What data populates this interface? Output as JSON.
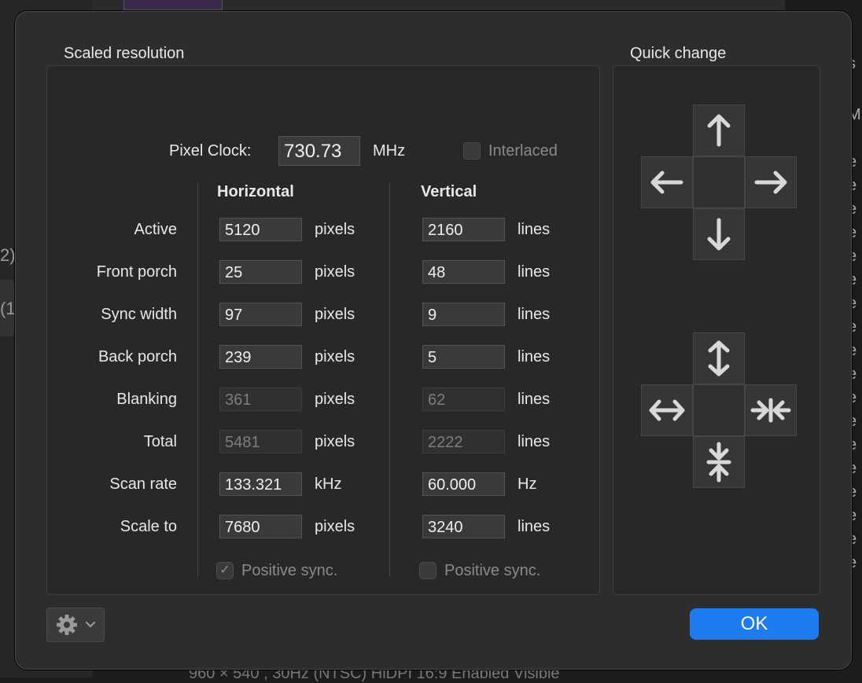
{
  "dialog": {
    "scaled_resolution_title": "Scaled resolution",
    "quick_change_title": "Quick change",
    "pixel_clock_label": "Pixel Clock:",
    "pixel_clock_value": "730.73",
    "pixel_clock_unit": "MHz",
    "interlaced_label": "Interlaced",
    "interlaced_checked": false,
    "horizontal_header": "Horizontal",
    "vertical_header": "Vertical",
    "rows": [
      {
        "label": "Active",
        "h": "5120",
        "h_unit": "pixels",
        "v": "2160",
        "v_unit": "lines",
        "editable": true
      },
      {
        "label": "Front porch",
        "h": "25",
        "h_unit": "pixels",
        "v": "48",
        "v_unit": "lines",
        "editable": true
      },
      {
        "label": "Sync width",
        "h": "97",
        "h_unit": "pixels",
        "v": "9",
        "v_unit": "lines",
        "editable": true
      },
      {
        "label": "Back porch",
        "h": "239",
        "h_unit": "pixels",
        "v": "5",
        "v_unit": "lines",
        "editable": true
      },
      {
        "label": "Blanking",
        "h": "361",
        "h_unit": "pixels",
        "v": "62",
        "v_unit": "lines",
        "editable": false
      },
      {
        "label": "Total",
        "h": "5481",
        "h_unit": "pixels",
        "v": "2222",
        "v_unit": "lines",
        "editable": false
      },
      {
        "label": "Scan rate",
        "h": "133.321",
        "h_unit": "kHz",
        "v": "60.000",
        "v_unit": "Hz",
        "editable": true
      },
      {
        "label": "Scale to",
        "h": "7680",
        "h_unit": "pixels",
        "v": "3240",
        "v_unit": "lines",
        "editable": true
      }
    ],
    "h_positive_sync_label": "Positive sync.",
    "h_positive_sync_checked": true,
    "v_positive_sync_label": "Positive sync.",
    "v_positive_sync_checked": false,
    "ok_label": "OK",
    "accent_color": "#1c7cf0"
  },
  "background": {
    "left_text_1": "2)",
    "left_text_2": "(1",
    "right_letters": [
      "s",
      "M",
      "e",
      "e",
      "e",
      "e",
      "e",
      "e",
      "e",
      "e",
      "e",
      "e",
      "e",
      "e",
      "e",
      "e",
      "e",
      "e",
      "e",
      "e"
    ],
    "bottom_text": "960 × 540   , 30Hz (NTSC)    HiDPI    16:9                         Enabled         Visible"
  }
}
